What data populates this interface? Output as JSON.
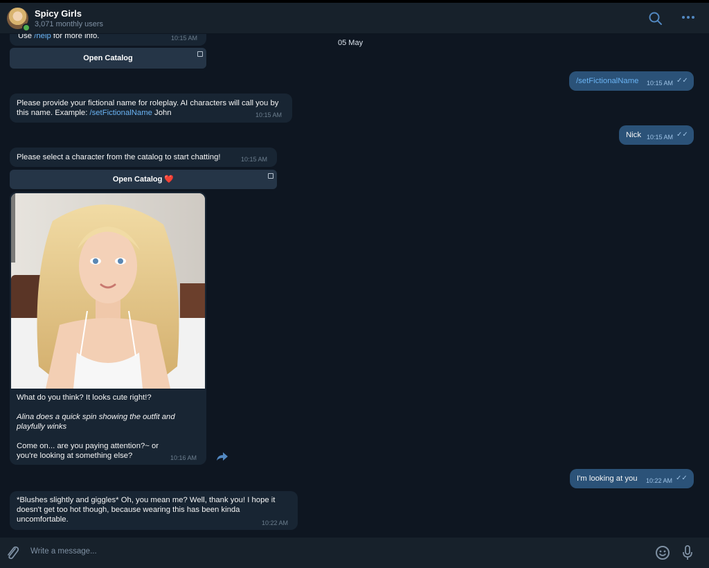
{
  "header": {
    "title": "Spicy Girls",
    "subtitle": "3,071 monthly users",
    "icons": [
      "search-icon",
      "more-icon"
    ]
  },
  "chat": {
    "date": "05 May",
    "messages": [
      {
        "id": "m1",
        "dir": "in",
        "text_prefix": "Use ",
        "link": "/help",
        "text_suffix": " for more info.",
        "time": "10:15 AM"
      },
      {
        "id": "m1_btn",
        "type": "button",
        "label": "Open Catalog"
      },
      {
        "id": "m2",
        "dir": "out",
        "text": "/setFictionalName",
        "time": "10:15 AM"
      },
      {
        "id": "m3",
        "dir": "in",
        "text": "Please provide your fictional name for roleplay. AI characters will call you by this name. Example: ",
        "cmd": "/setFictionalName",
        "suffix": " John",
        "time": "10:15 AM"
      },
      {
        "id": "m4",
        "dir": "out",
        "text": "Nick",
        "time": "10:15 AM"
      },
      {
        "id": "m5",
        "dir": "in",
        "text": "Please select a character from the catalog to start chatting!",
        "time": "10:15 AM"
      },
      {
        "id": "m5_btn",
        "type": "button",
        "label": "Open Catalog ❤️"
      },
      {
        "id": "m6",
        "dir": "in",
        "type": "photo",
        "line1": "What do you think? It looks cute right!?",
        "line2": "Alina does a quick spin showing the outfit and playfully winks",
        "line3": "Come on... are you paying attention?~ or you're looking at something else?",
        "time": "10:16 AM"
      },
      {
        "id": "m7",
        "dir": "out",
        "text": "I'm looking at you",
        "time": "10:22 AM"
      },
      {
        "id": "m8",
        "dir": "in",
        "text": "*Blushes slightly and giggles* Oh, you mean me? Well, thank you! I hope it doesn't get too hot though, because wearing this has been kinda uncomfortable.",
        "time": "10:22 AM"
      }
    ]
  },
  "composer": {
    "placeholder": "Write a message...",
    "icons": [
      "attach-icon",
      "emoji-icon",
      "microphone-icon"
    ]
  },
  "colors": {
    "background": "#0e1621",
    "incoming": "#182533",
    "outgoing": "#2b5278",
    "link": "#6ab3f3",
    "accent": "#5288c1"
  }
}
